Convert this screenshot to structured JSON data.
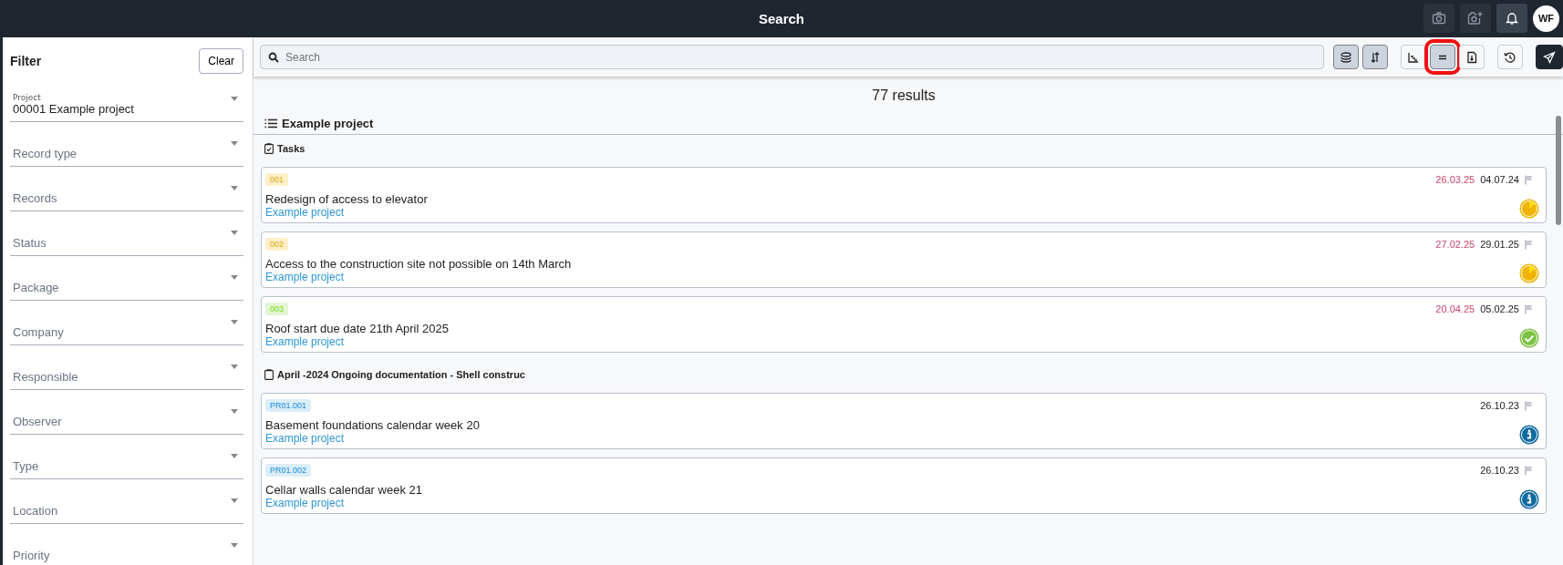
{
  "header": {
    "title": "Search",
    "actions": [
      {
        "kind": "camera",
        "selected": false
      },
      {
        "kind": "camera-add",
        "selected": false
      },
      {
        "kind": "bell",
        "selected": true
      }
    ],
    "avatar": "WF"
  },
  "filter": {
    "title": "Filter",
    "clear": "Clear",
    "fields": [
      {
        "label": "Project",
        "value": "00001 Example project"
      },
      {
        "placeholder": "Record type"
      },
      {
        "placeholder": "Records"
      },
      {
        "placeholder": "Status"
      },
      {
        "placeholder": "Package"
      },
      {
        "placeholder": "Company"
      },
      {
        "placeholder": "Responsible"
      },
      {
        "placeholder": "Observer"
      },
      {
        "placeholder": "Type"
      },
      {
        "placeholder": "Location"
      },
      {
        "placeholder": "Priority"
      }
    ]
  },
  "search": {
    "placeholder": "Search"
  },
  "toolbar": [
    {
      "kind": "layers",
      "selected": true,
      "highlighted": false
    },
    {
      "kind": "sort",
      "selected": true,
      "highlighted": false
    },
    {
      "kind": "chart",
      "selected": false,
      "highlighted": false
    },
    {
      "kind": "list",
      "selected": true,
      "highlighted": true
    },
    {
      "kind": "document",
      "selected": false,
      "highlighted": false
    },
    {
      "kind": "history",
      "selected": false,
      "highlighted": false
    },
    {
      "kind": "send",
      "selected": true,
      "highlighted": false
    }
  ],
  "results": "77 results",
  "project": "Example project",
  "groups": [
    {
      "kind": "tasks",
      "title": "Tasks",
      "items": [
        {
          "tag": "001",
          "color": "#fff0c8",
          "due": "26.03.25",
          "date": "04.07.24",
          "title": "Redesign of access to elevator",
          "project": "Example project",
          "kind": "in_progress"
        },
        {
          "tag": "002",
          "color": "#fff0c8",
          "due": "27.02.25",
          "date": "29.01.25",
          "title": "Access to the construction site not possible on 14th March",
          "project": "Example project",
          "kind": "in_progress"
        },
        {
          "tag": "003",
          "color": "#e4f5d6",
          "due": "20.04.25",
          "date": "05.02.25",
          "title": "Roof start due date 21th April 2025",
          "project": "Example project",
          "kind": "done"
        }
      ]
    },
    {
      "kind": "protocol",
      "title": "April -2024 Ongoing documentation - Shell construc",
      "items": [
        {
          "tag": "PR01.001",
          "color": "#dcedf8",
          "date": "26.10.23",
          "title": "Basement foundations calendar week 20",
          "project": "Example project",
          "kind": "info"
        },
        {
          "tag": "PR01.002",
          "color": "#dcedf8",
          "date": "26.10.23",
          "title": "Cellar walls calendar week 21",
          "project": "Example project",
          "kind": "info"
        }
      ]
    }
  ]
}
